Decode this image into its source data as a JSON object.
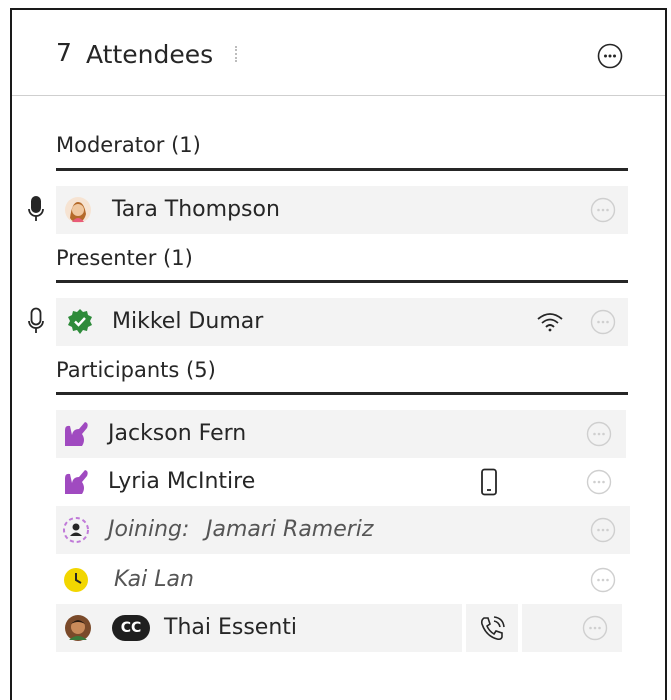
{
  "header": {
    "count": "7",
    "title": "Attendees",
    "more_icon": "more-options-icon"
  },
  "sections": {
    "moderator": {
      "title": "Moderator (1)"
    },
    "presenter": {
      "title": "Presenter (1)"
    },
    "participants": {
      "title": "Participants (5)"
    }
  },
  "attendees": {
    "tara": {
      "name": "Tara Thompson",
      "role": "moderator",
      "status_icon": "microphone-icon",
      "avatar": "profile-photo"
    },
    "mikkel": {
      "name": "Mikkel Dumar",
      "role": "presenter",
      "status_icon": "microphone-outline-icon",
      "avatar": "presenter-badge-icon",
      "connection": "wifi-icon"
    },
    "jackson": {
      "name": "Jackson Fern",
      "avatar": "raised-hand-icon"
    },
    "lyria": {
      "name": "Lyria McIntire",
      "avatar": "raised-hand-icon",
      "device": "mobile-phone-icon"
    },
    "jamari": {
      "joining_label": "Joining:",
      "name": "Jamari Rameriz",
      "avatar": "joining-user-icon"
    },
    "kai": {
      "name": "Kai Lan",
      "avatar": "away-clock-icon"
    },
    "thai": {
      "name": "Thai Essenti",
      "avatar": "profile-photo",
      "badge": "CC",
      "device": "phone-call-icon"
    }
  },
  "colors": {
    "text": "#262626",
    "rule": "#262626",
    "row_bg": "#f3f3f3",
    "raised_hand": "#a04ac0",
    "presenter_badge": "#2e8b3a",
    "away_clock": "#f2d600"
  }
}
